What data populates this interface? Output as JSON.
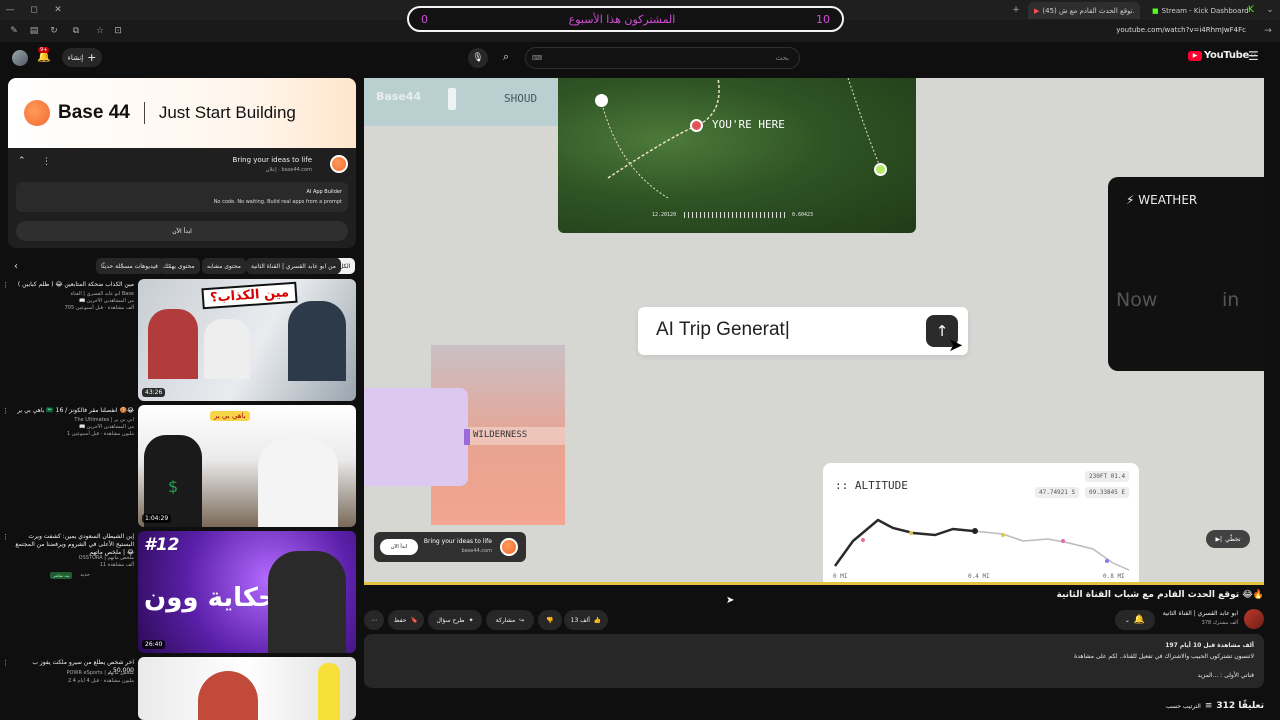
{
  "browser": {
    "tabs": [
      {
        "label": "(45) توقع الحدث القادم مع ش..."
      },
      {
        "label": "Stream - Kick Dashboard"
      }
    ],
    "url": "youtube.com/watch?v=i4RhmJwF4Fc"
  },
  "banner": {
    "left_number": "10",
    "text": "المشتركون هذا الأسبوع",
    "right_number": "0"
  },
  "header": {
    "create_label": "إنشاء",
    "notification_count": "9+",
    "search_placeholder": "بحث",
    "logo_text": "YouTube",
    "logo_region": "SA"
  },
  "ad": {
    "brand": "Base 44",
    "slogan": "Just Start Building",
    "title": "Bring your ideas to life",
    "sponsor_line": "إعلان · base44.com",
    "product_title": "AI App Builder",
    "product_desc": "No code. No waiting. Build real apps from a prompt",
    "cta": "ابدأ الآن"
  },
  "chips": [
    "الكل",
    "من ابو عابد القسري | القناة الثانية",
    "محتوى مشابه",
    "محتوى يهمّك",
    "فيديوهات مسجّلة حديثًا"
  ],
  "recommended": [
    {
      "title": "مين الكذاب ضحكة المتابعين 😂 ( ظلم كبابين )",
      "channel": "ابو عابد القسري | القناة Base",
      "meta": "705 ألف مشاهدة · قبل أسبوعين",
      "extra": "📖 من المشاهدين الآخرين",
      "duration": "43:26",
      "thumb_text": "مين الكذاب؟"
    },
    {
      "title": "باهي بي ير 🇸🇦 16 / انفصلنا مقر فالكونز 🍪😂",
      "channel": "The Ultimates | ابي بي ير",
      "meta": "1 مليون مشاهدة · قبل أسبوعين",
      "extra": "📖 من المشاهدين الآخرين",
      "duration": "1:04:29",
      "thumb_text": "باهي بي ير"
    },
    {
      "title": "إبن الشيطان السعودي يمين: كشفت ويرث البستيج الأعلى في الشروم ويرفضنا من المجتمع 😂 | ملخص ماتهم",
      "channel": "OSSTORA | ملخص ماتهم",
      "meta": "11 ألف مشاهدة",
      "extra": "جديد",
      "duration": "26:40",
      "thumb_text": "حكاية وون",
      "badge": "بث مباشر"
    },
    {
      "title": "اخر شخص يطلع من سيرو ملكت يفوز ب 50,000 ر",
      "channel": "POWR eSports | ملخص ماتهم",
      "meta": "2.4 مليون مشاهدة · قبل 4 أيام",
      "extra": "",
      "duration": "",
      "thumb_text": ""
    }
  ],
  "player": {
    "shoud_label": "SHOUD",
    "logo_ghost": "Base44",
    "map_label": "YOU'RE HERE",
    "map_coord_left": "12.20120",
    "map_coord_right": "0.60423",
    "prompt_text": "AI Trip Generat|",
    "wilderness_label": "WILDERNESS",
    "weather_label": "WEATHER",
    "weather_now": "Now",
    "weather_in": "in",
    "altitude_label": "ALTITUDE",
    "alt_badge1": "230FT 01.4",
    "alt_badge2a": "47.74921 S",
    "alt_badge2b": "09.33845 E",
    "alt_x0": "0 MI",
    "alt_x1": "0.4 MI",
    "alt_x2": "0.8 MI",
    "overlay_ad_title": "Bring your ideas to life",
    "overlay_ad_site": "base44.com",
    "overlay_ad_cta": "ابدأ الآن",
    "skip_label": "تخطّي"
  },
  "video": {
    "title": "توقع الحدث القادم مع شباب القناة الثانية 😂🔥",
    "channel": "ابو عابد القسري | القناة الثانية",
    "subscribers": "378 ألف مشترك",
    "likes": "13 ألف",
    "share": "مشاركة",
    "ask": "طرح سؤال",
    "save": "حفظ"
  },
  "description": {
    "stats": "197 ألف مشاهدة قبل 10 أيام",
    "line1": "لاتنسون تشتركون الحبيب والاشتراك في تفعيل للقناة.. لكم على مشاهدة",
    "line2": "قناتي الأولى : ...المزيد"
  },
  "comments": {
    "count": "312 تعليقًا",
    "sort_label": "الترتيب حسب"
  },
  "colors": {
    "accent_red": "#ff0033",
    "base44_orange": "#f26a2e",
    "progress": "#e3c23f"
  }
}
